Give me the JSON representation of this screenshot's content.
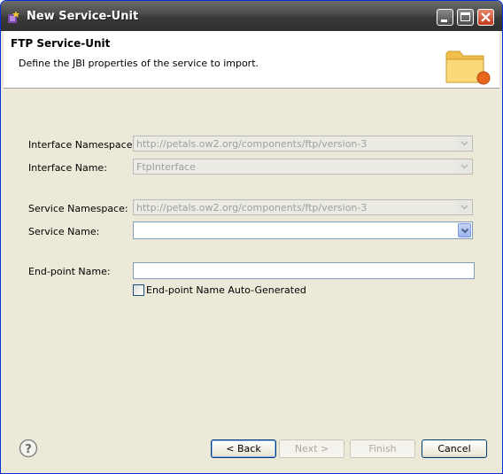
{
  "window": {
    "title": "New Service-Unit",
    "icons": {
      "app": "eclipse-wizard-icon",
      "minimize": "minimize-icon",
      "maximize": "maximize-icon",
      "close": "close-icon"
    }
  },
  "banner": {
    "title": "FTP Service-Unit",
    "description": "Define the JBI properties of the service to import.",
    "icon": "folder-icon"
  },
  "form": {
    "interface_namespace": {
      "label": "Interface Namespace:",
      "value": "http://petals.ow2.org/components/ftp/version-3"
    },
    "interface_name": {
      "label": "Interface Name:",
      "value": "FtpInterface"
    },
    "service_namespace": {
      "label": "Service Namespace:",
      "value": "http://petals.ow2.org/components/ftp/version-3"
    },
    "service_name": {
      "label": "Service Name:",
      "value": ""
    },
    "endpoint_name": {
      "label": "End-point Name:",
      "value": ""
    },
    "endpoint_autogen": {
      "label": "End-point Name Auto-Generated",
      "checked": false
    }
  },
  "footer": {
    "help_icon": "help-icon",
    "back": "< Back",
    "next": "Next >",
    "finish": "Finish",
    "cancel": "Cancel"
  },
  "colors": {
    "titlebar": "#3a3a3a",
    "dialog_bg": "#ece9d8",
    "accent": "#0831d9"
  }
}
